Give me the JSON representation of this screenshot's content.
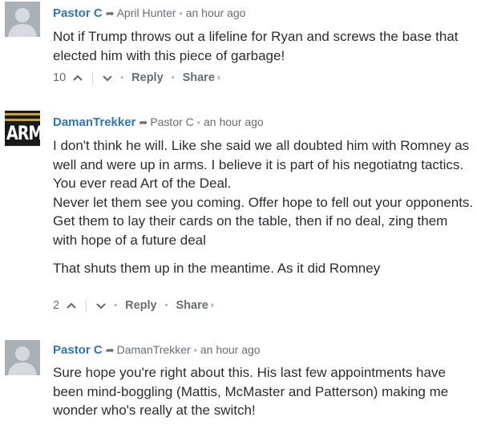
{
  "comments": [
    {
      "author": "Pastor C",
      "reply_to": "April Hunter",
      "time": "an hour ago",
      "paragraphs": [
        "Not if Trump throws out a lifeline for Ryan and screws the base that elected him with this piece of garbage!"
      ],
      "upvotes": "10",
      "reply_label": "Reply",
      "share_label": "Share",
      "avatar": "default-avatar"
    },
    {
      "author": "DamanTrekker",
      "reply_to": "Pastor C",
      "time": "an hour ago",
      "paragraphs": [
        "I don't think he will. Like she said we all doubted him with Romney as well and were up in arms. I believe it is part of his negotiatng tactics. You ever read Art of the Deal.",
        "Never let them see you coming. Offer hope to fell out your opponents. Get them to lay their cards on the table, then if no deal, zing them with hope of a future deal",
        "That shuts them up in the meantime. As it did Romney"
      ],
      "upvotes": "2",
      "reply_label": "Reply",
      "share_label": "Share",
      "avatar_text": "ARMY"
    },
    {
      "author": "Pastor C",
      "reply_to": "DamanTrekker",
      "time": "an hour ago",
      "paragraphs": [
        "Sure hope you're right about this. His last few appointments have been mind-boggling (Mattis, McMaster and Patterson) making me wonder who's really at the switch!"
      ],
      "avatar": "default-avatar"
    }
  ],
  "icons": {
    "reply_arrow": "reply-arrow-icon",
    "upvote": "chevron-up-icon",
    "downvote": "chevron-down-icon",
    "share": "chevron-right-icon"
  },
  "colors": {
    "author": "#2e76b9",
    "meta": "#666d74",
    "text": "#2a2e2e",
    "avatar_bg": "#a9b0b6"
  }
}
